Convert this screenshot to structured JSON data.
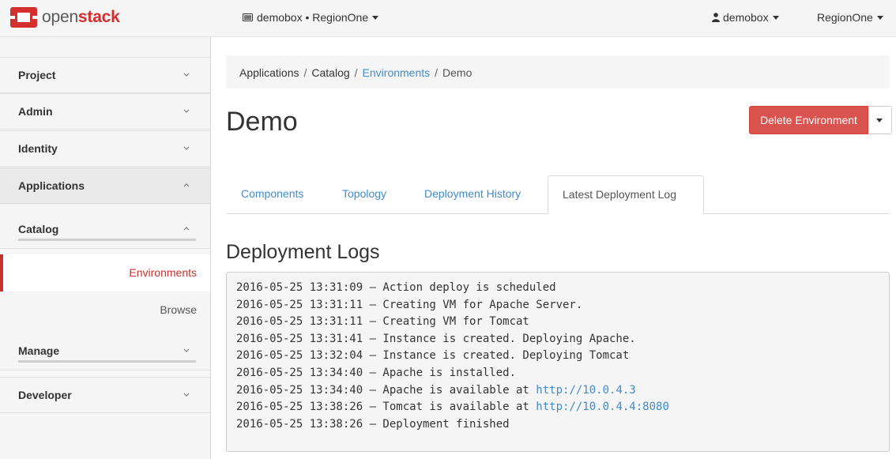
{
  "brand": {
    "open": "open",
    "stack": "stack"
  },
  "navbar": {
    "project_selector": "demobox • RegionOne",
    "user_menu": "demobox",
    "region_menu": "RegionOne"
  },
  "sidebar": {
    "project": "Project",
    "admin": "Admin",
    "identity": "Identity",
    "applications": "Applications",
    "catalog": "Catalog",
    "environments": "Environments",
    "browse": "Browse",
    "manage": "Manage",
    "developer": "Developer"
  },
  "breadcrumb": {
    "items": [
      "Applications",
      "Catalog",
      "Environments",
      "Demo"
    ],
    "separator": "/"
  },
  "page": {
    "title": "Demo",
    "delete_button": "Delete Environment"
  },
  "tabs": [
    "Components",
    "Topology",
    "Deployment History",
    "Latest Deployment Log"
  ],
  "logs": {
    "heading": "Deployment Logs",
    "lines": [
      {
        "text": "2016-05-25 13:31:09 — Action deploy is scheduled",
        "link": ""
      },
      {
        "text": "2016-05-25 13:31:11 — Creating VM for Apache Server.",
        "link": ""
      },
      {
        "text": "2016-05-25 13:31:11 — Creating VM for Tomcat",
        "link": ""
      },
      {
        "text": "2016-05-25 13:31:41 — Instance is created. Deploying Apache.",
        "link": ""
      },
      {
        "text": "2016-05-25 13:32:04 — Instance is created. Deploying Tomcat",
        "link": ""
      },
      {
        "text": "2016-05-25 13:34:40 — Apache is installed.",
        "link": ""
      },
      {
        "text": "2016-05-25 13:34:40 — Apache is available at ",
        "link": "http://10.0.4.3"
      },
      {
        "text": "2016-05-25 13:38:26 — Tomcat is available at ",
        "link": "http://10.0.4.4:8080"
      },
      {
        "text": "2016-05-25 13:38:26 — Deployment finished",
        "link": ""
      }
    ]
  },
  "colors": {
    "brand_red": "#d42f2f",
    "danger": "#d9534f",
    "link": "#428bca",
    "active_marker": "#c9302c"
  }
}
